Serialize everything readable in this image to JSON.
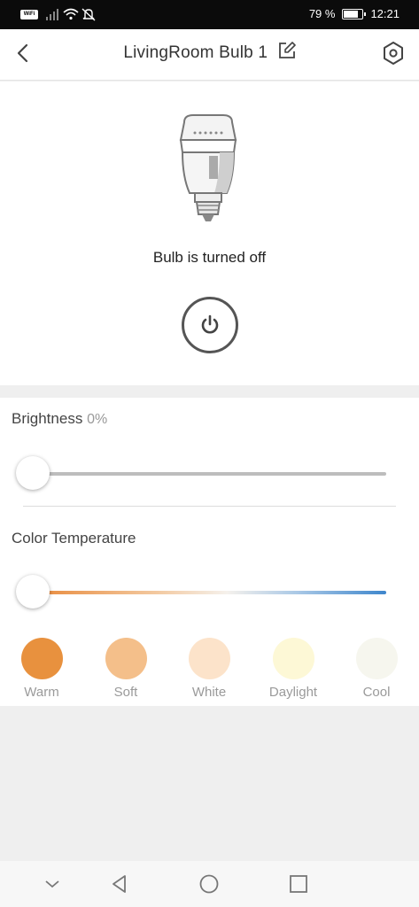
{
  "status_bar": {
    "wifi_tag": "WiFi",
    "battery_text": "79 %",
    "battery_level": 0.79,
    "time": "12:21"
  },
  "header": {
    "title": "LivingRoom Bulb 1",
    "back_icon": "chevron-left-icon",
    "edit_icon": "edit-icon",
    "settings_icon": "hexagon-settings-icon"
  },
  "bulb": {
    "status_text": "Bulb is turned off",
    "power_icon": "power-icon"
  },
  "brightness": {
    "label": "Brightness",
    "value_text": "0%",
    "value": 0
  },
  "color_temperature": {
    "label": "Color Temperature",
    "value": 0
  },
  "presets": [
    {
      "label": "Warm",
      "color": "#e8913e"
    },
    {
      "label": "Soft",
      "color": "#f4bf8a"
    },
    {
      "label": "White",
      "color": "#fce3ca"
    },
    {
      "label": "Daylight",
      "color": "#fdf8d6"
    },
    {
      "label": "Cool",
      "color": "#f6f6ee"
    }
  ],
  "nav_bar": {
    "icons": [
      "chevron-down-icon",
      "back-triangle-icon",
      "home-circle-icon",
      "recents-square-icon"
    ]
  }
}
